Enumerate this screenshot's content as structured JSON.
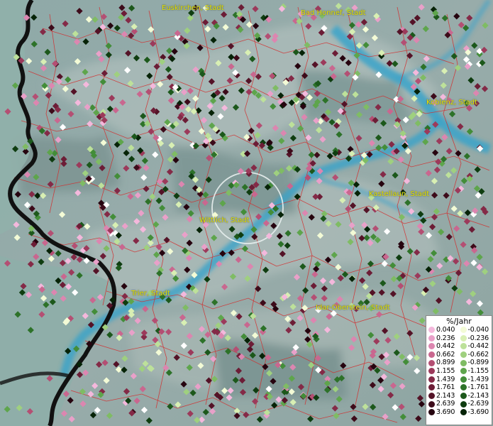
{
  "map": {
    "cities": [
      {
        "name": "Euskirchen, Stadt"
      },
      {
        "name": "Bad Honnef, Stadt"
      },
      {
        "name": "Koblenz, Stadt"
      },
      {
        "name": "Kastellaun, Stadt"
      },
      {
        "name": "Wittlich, Stadt"
      },
      {
        "name": "Trier, Stadt"
      },
      {
        "name": "Idar-Oberstein, Stadt"
      }
    ]
  },
  "legend": {
    "title": "%/Jahr",
    "positive": [
      {
        "label": "0.040",
        "color": "#f4b8dc"
      },
      {
        "label": "0.236",
        "color": "#e9a0c9"
      },
      {
        "label": "0.442",
        "color": "#dc86b0"
      },
      {
        "label": "0.662",
        "color": "#c9678f"
      },
      {
        "label": "0.899",
        "color": "#b44f73"
      },
      {
        "label": "1.155",
        "color": "#9c3a5b"
      },
      {
        "label": "1.439",
        "color": "#842a47"
      },
      {
        "label": "1.761",
        "color": "#6c1d36"
      },
      {
        "label": "2.143",
        "color": "#541327"
      },
      {
        "label": "2.639",
        "color": "#3d0b1a"
      },
      {
        "label": "3.690",
        "color": "#26040f"
      }
    ],
    "negative": [
      {
        "label": "-0.040",
        "color": "#f3fbd6"
      },
      {
        "label": "-0.236",
        "color": "#d8efb3"
      },
      {
        "label": "-0.442",
        "color": "#bde19a"
      },
      {
        "label": "-0.662",
        "color": "#9fd07f"
      },
      {
        "label": "-0.899",
        "color": "#7fbc64"
      },
      {
        "label": "-1.155",
        "color": "#5ea54c"
      },
      {
        "label": "-1.439",
        "color": "#438d39"
      },
      {
        "label": "-1.761",
        "color": "#2d7229"
      },
      {
        "label": "-2.143",
        "color": "#1c581b"
      },
      {
        "label": "-2.639",
        "color": "#0f3d10"
      },
      {
        "label": "-3.690",
        "color": "#062307"
      }
    ]
  }
}
